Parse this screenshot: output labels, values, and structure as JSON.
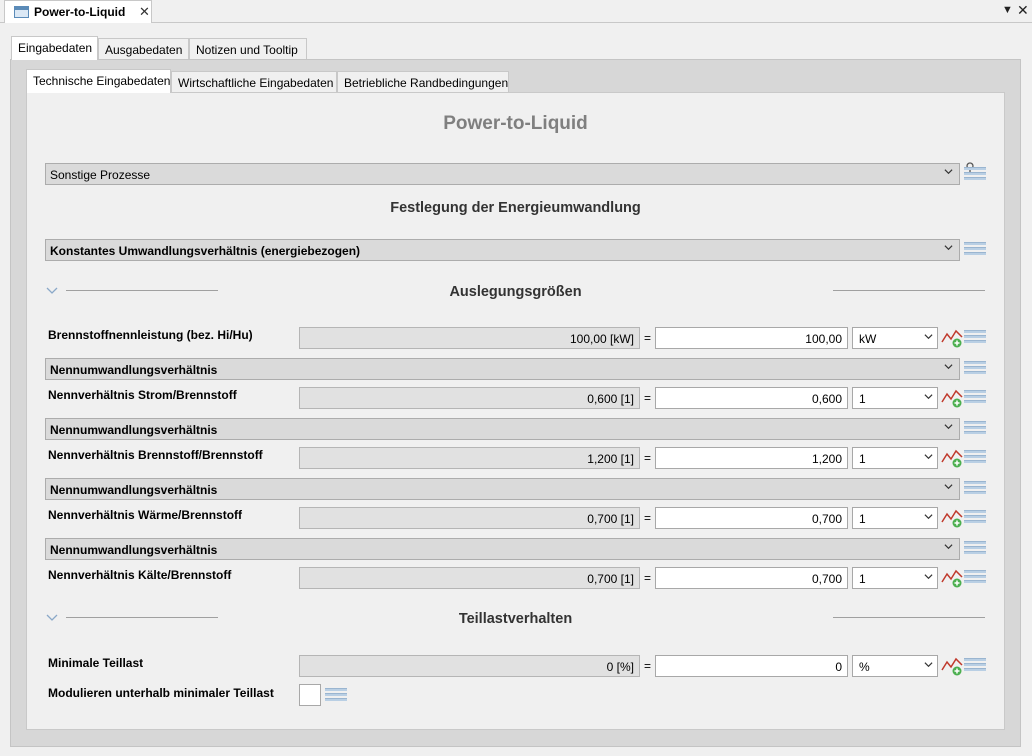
{
  "editor": {
    "tab_title": "Power-to-Liquid",
    "close_glyph": "✕",
    "menu_glyph": "▼",
    "window_close_glyph": "✕"
  },
  "outer_tabs": [
    "Eingabedaten",
    "Ausgabedaten",
    "Notizen und Tooltip"
  ],
  "inner_tabs": [
    "Technische Eingabedaten",
    "Wirtschaftliche Eingabedaten",
    "Betriebliche Randbedingungen"
  ],
  "main": {
    "title": "Power-to-Liquid",
    "process_select": "Sonstige Prozesse",
    "energy_section_title": "Festlegung der Energieumwandlung",
    "energy_select": "Konstantes Umwandlungsverhältnis (energiebezogen)",
    "design_section_title": "Auslegungsgrößen",
    "partload_section_title": "Teillastverhalten"
  },
  "rows": [
    {
      "label": "Brennstoffnennleistung (bez. Hi/Hu)",
      "readonly": "100,00 [kW]",
      "value": "100,00",
      "unit": "kW"
    },
    {
      "section": "Nennumwandlungsverhältnis",
      "label": "Nennverhältnis Strom/Brennstoff",
      "readonly": "0,600 [1]",
      "value": "0,600",
      "unit": "1"
    },
    {
      "section": "Nennumwandlungsverhältnis",
      "label": "Nennverhältnis Brennstoff/Brennstoff",
      "readonly": "1,200 [1]",
      "value": "1,200",
      "unit": "1"
    },
    {
      "section": "Nennumwandlungsverhältnis",
      "label": "Nennverhältnis Wärme/Brennstoff",
      "readonly": "0,700 [1]",
      "value": "0,700",
      "unit": "1"
    },
    {
      "section": "Nennumwandlungsverhältnis",
      "label": "Nennverhältnis Kälte/Brennstoff",
      "readonly": "0,700 [1]",
      "value": "0,700",
      "unit": "1"
    }
  ],
  "partload": {
    "min_label": "Minimale Teillast",
    "min_readonly": "0 [%]",
    "min_value": "0",
    "min_unit": "%",
    "modulate_label": "Modulieren unterhalb minimaler Teillast"
  },
  "equals": "=",
  "colors": {
    "title_gray": "#7f7f7f",
    "hamburger_blue": "#b9cfe4",
    "trend_red": "#c0392b",
    "trend_green": "#4caf50"
  }
}
